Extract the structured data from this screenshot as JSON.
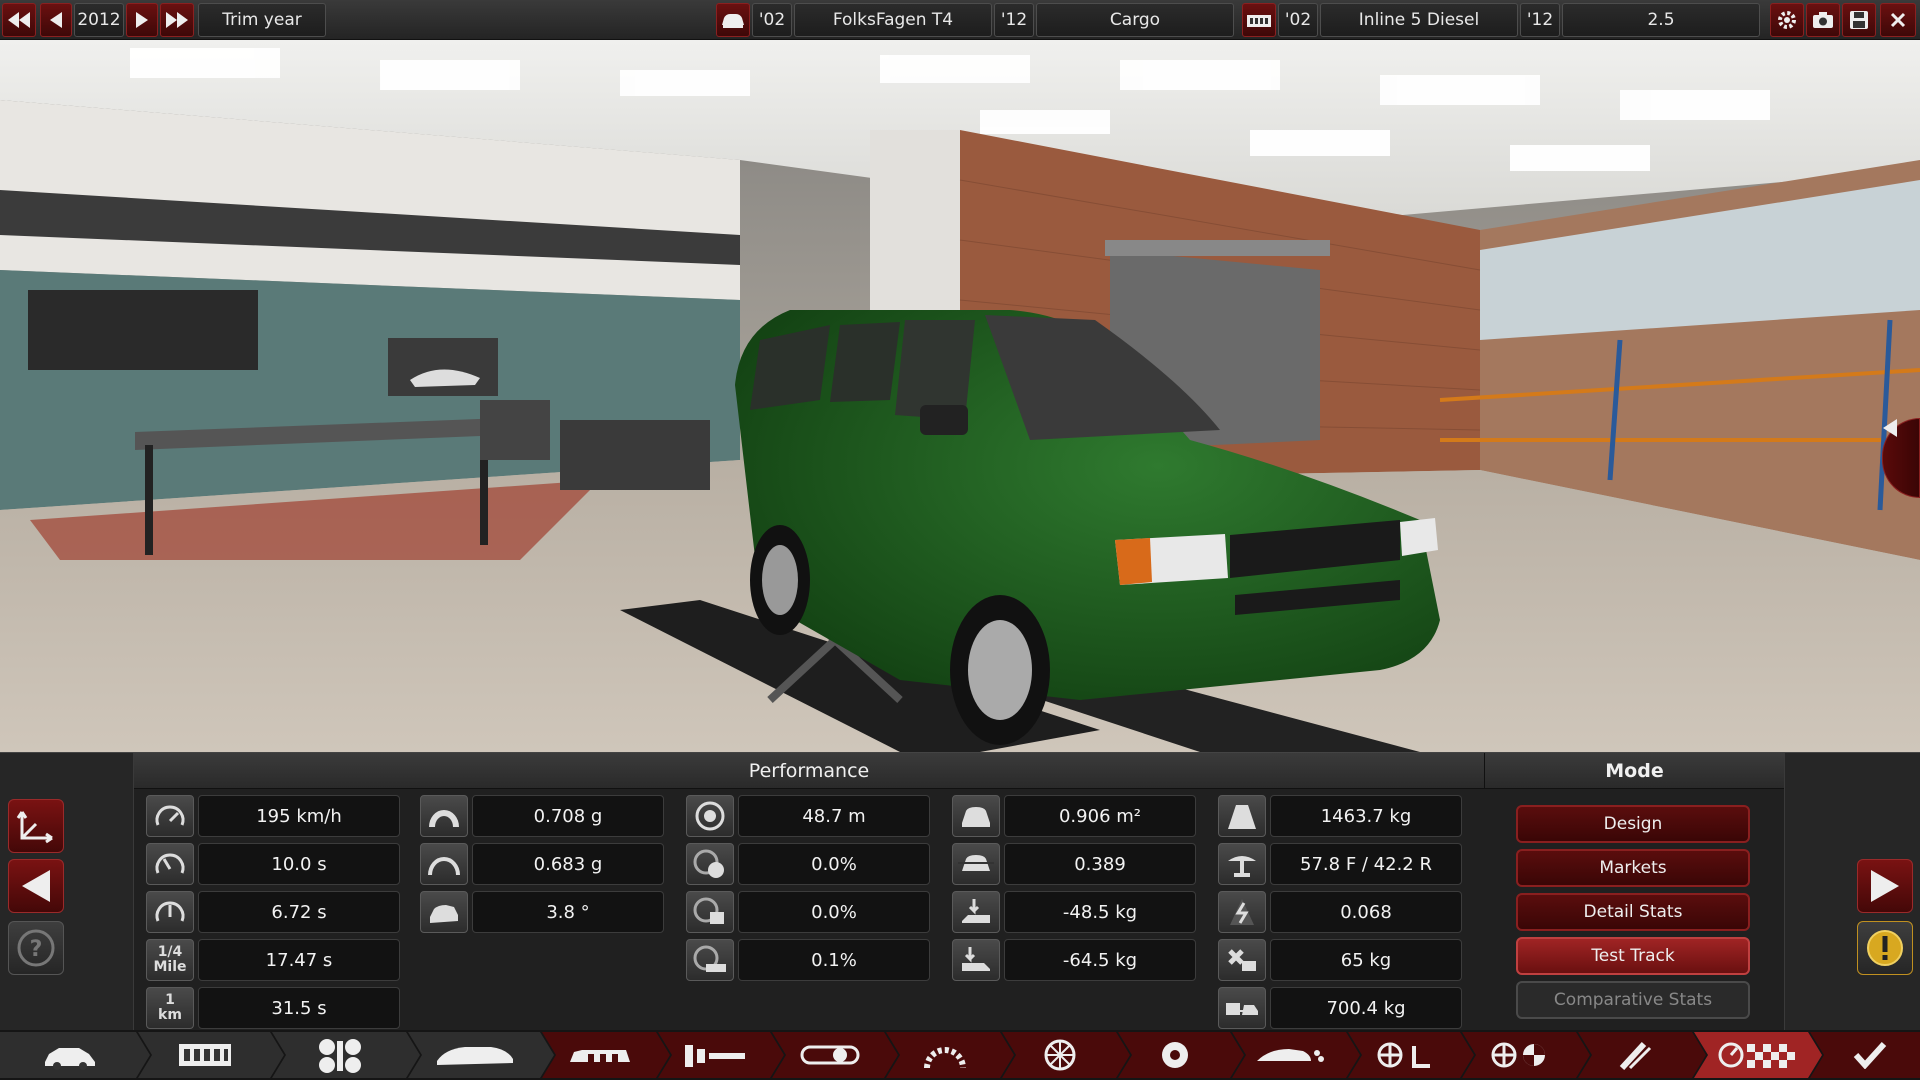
{
  "topbar": {
    "year": "2012",
    "trim_year_label": "Trim year",
    "model_year": "'02",
    "model_name": "FolksFagen T4",
    "trim_model_year": "'12",
    "trim_name": "Cargo",
    "engine_year": "'02",
    "engine_name": "Inline 5 Diesel",
    "engine_variant_year": "'12",
    "engine_variant_name": "2.5"
  },
  "performance": {
    "header": "Performance",
    "col1": [
      {
        "icon": "top-speed-icon",
        "value": "195 km/h"
      },
      {
        "icon": "acceleration-0-100-icon",
        "value": "10.0 s"
      },
      {
        "icon": "acceleration-80-120-icon",
        "value": "6.72 s"
      },
      {
        "icon": "quarter-mile-icon",
        "icon_text": "1/4\nMile",
        "value": "17.47 s"
      },
      {
        "icon": "one-km-icon",
        "icon_text": "1\nkm",
        "value": "31.5 s"
      }
    ],
    "col2": [
      {
        "icon": "cornering-low-speed-icon",
        "value": "0.708 g"
      },
      {
        "icon": "cornering-high-speed-icon",
        "value": "0.683 g"
      },
      {
        "icon": "body-roll-icon",
        "value": "3.8 °"
      }
    ],
    "col3": [
      {
        "icon": "braking-distance-icon",
        "value": "48.7 m"
      },
      {
        "icon": "brake-fade-icon",
        "value": "0.0%"
      },
      {
        "icon": "brake-fade-race-icon",
        "value": "0.0%"
      },
      {
        "icon": "brake-fade-tow-icon",
        "value": "0.1%"
      }
    ],
    "col4": [
      {
        "icon": "frontal-area-icon",
        "value": "0.906 m²"
      },
      {
        "icon": "drag-coefficient-icon",
        "value": "0.389"
      },
      {
        "icon": "front-downforce-icon",
        "value": "-48.5 kg"
      },
      {
        "icon": "rear-downforce-icon",
        "value": "-64.5 kg"
      }
    ],
    "col5": [
      {
        "icon": "weight-icon",
        "value": "1463.7 kg"
      },
      {
        "icon": "weight-distribution-icon",
        "value": "57.8 F / 42.2 R"
      },
      {
        "icon": "center-of-gravity-icon",
        "value": "0.068"
      },
      {
        "icon": "payload-icon",
        "value": "65 kg"
      },
      {
        "icon": "towing-capacity-icon",
        "value": "700.4 kg"
      }
    ]
  },
  "mode": {
    "header": "Mode",
    "buttons": [
      {
        "label": "Design",
        "state": "normal"
      },
      {
        "label": "Markets",
        "state": "normal"
      },
      {
        "label": "Detail Stats",
        "state": "normal"
      },
      {
        "label": "Test Track",
        "state": "active"
      },
      {
        "label": "Comparative Stats",
        "state": "disabled"
      }
    ]
  },
  "nav": {
    "tabs": [
      "car-icon",
      "engine-block-icon",
      "drivetrain-icon",
      "body-icon",
      "seats-icon",
      "gearbox-icon",
      "suspension-icon",
      "tyres-icon",
      "rims-icon",
      "brakes-icon",
      "aero-icon",
      "interior-icon",
      "safety-icon",
      "fixtures-icon",
      "test-track-icon",
      "confirm-check-icon"
    ]
  },
  "colors": {
    "accent_red": "#8a1f1f",
    "active_red": "#a02424",
    "van_green": "#1f5a1f",
    "panel_bg": "#202020"
  }
}
